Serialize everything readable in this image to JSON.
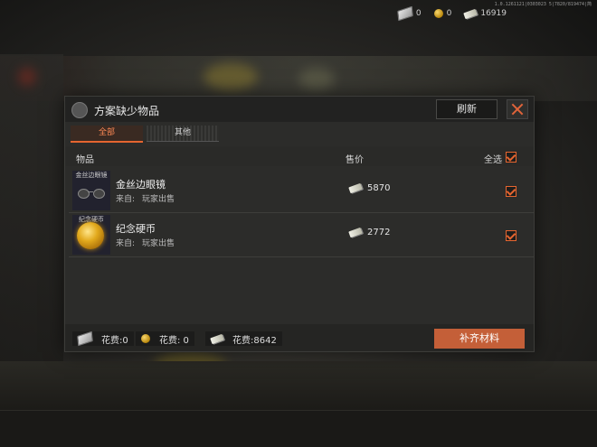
{
  "version": "1.0.1261121|0303023 5|7820/819474|简",
  "topbar": {
    "tickets": "0",
    "coins": "0",
    "cash": "16919"
  },
  "dialog": {
    "title": "方案缺少物品",
    "refresh_label": "刷新",
    "tabs": [
      {
        "label": "全部",
        "active": true
      },
      {
        "label": "其他",
        "active": false
      }
    ],
    "columns": {
      "item": "物品",
      "price": "售价",
      "select_all": "全选"
    },
    "items": [
      {
        "thumb_label": "金丝边眼镜",
        "name": "金丝边眼镜",
        "source_label": "来自:",
        "source": "玩家出售",
        "price": "5870",
        "checked": true,
        "icon": "glasses-icon"
      },
      {
        "thumb_label": "纪念硬币",
        "name": "纪念硬币",
        "source_label": "来自:",
        "source": "玩家出售",
        "price": "2772",
        "checked": true,
        "icon": "coin-icon"
      }
    ],
    "costs": [
      {
        "icon": "ticket-icon",
        "text": "花费:0"
      },
      {
        "icon": "coin-icon",
        "text": "花费: 0"
      },
      {
        "icon": "cash-icon",
        "text": "花费:8642"
      }
    ],
    "fill_button_label": "补齐材料"
  },
  "colors": {
    "accent": "#e5652f",
    "button": "#c45f38"
  }
}
